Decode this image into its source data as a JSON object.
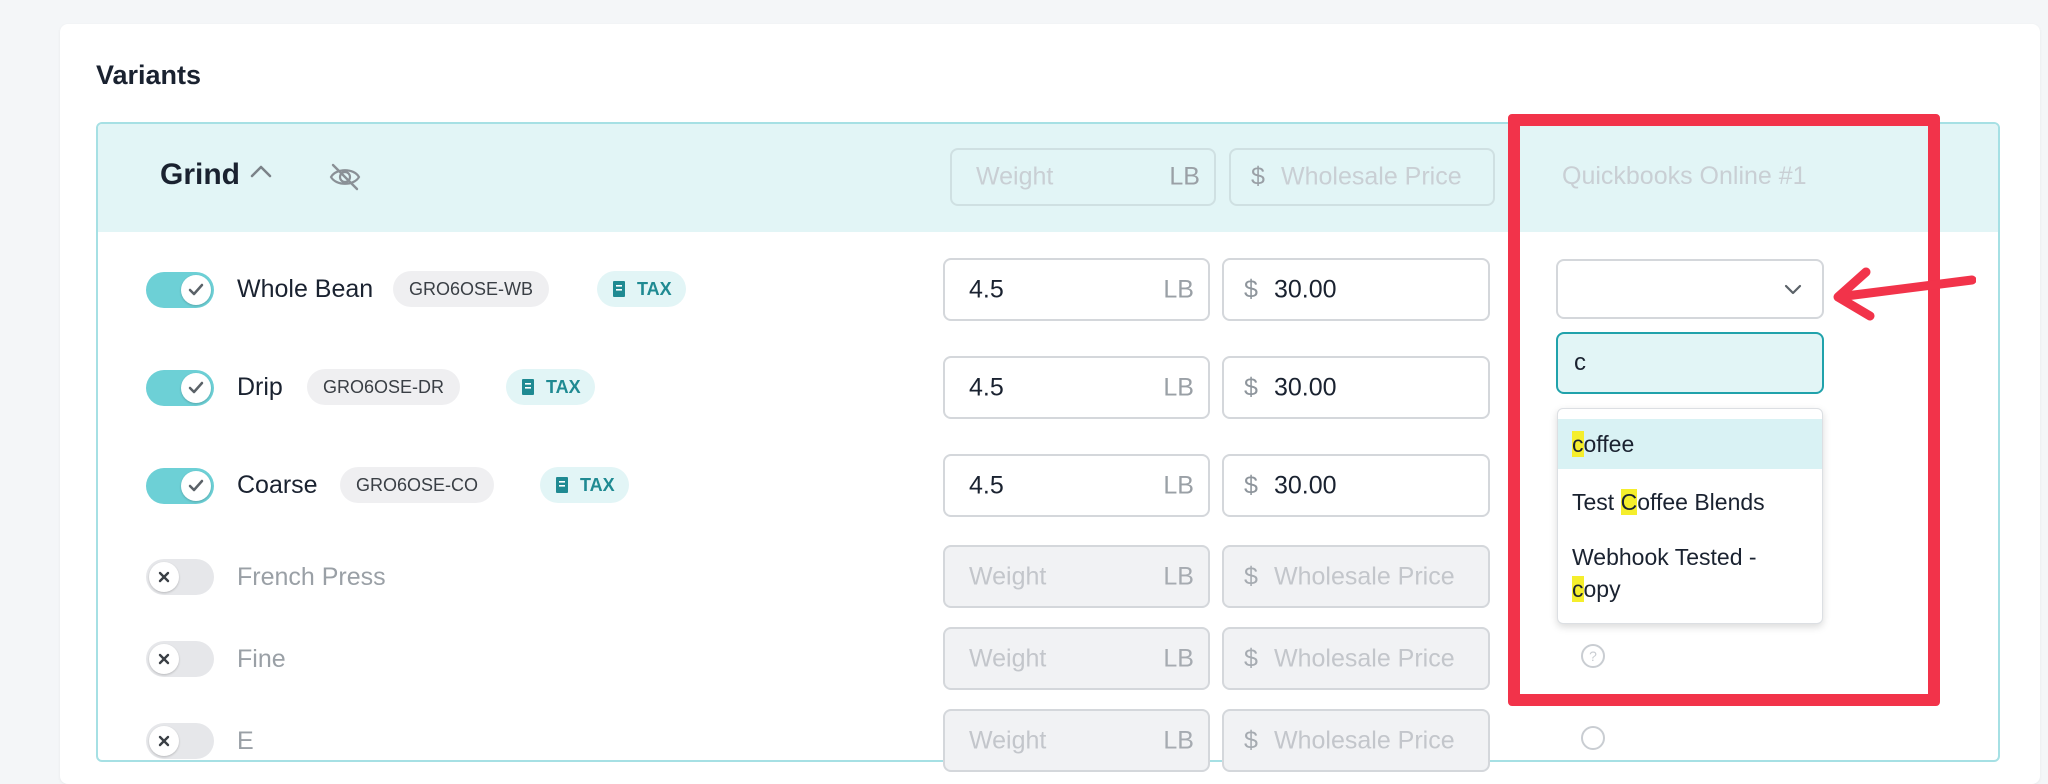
{
  "section_title": "Variants",
  "group": {
    "name": "Grind",
    "weight_placeholder": "Weight",
    "weight_unit": "LB",
    "currency_symbol": "$",
    "price_placeholder": "Wholesale Price",
    "integration_header": "Quickbooks Online #1"
  },
  "variants": [
    {
      "name": "Whole Bean",
      "enabled": true,
      "sku": "GRO6OSE-WB",
      "tax_label": "TAX",
      "weight": "4.5",
      "price": "30.00"
    },
    {
      "name": "Drip",
      "enabled": true,
      "sku": "GRO6OSE-DR",
      "tax_label": "TAX",
      "weight": "4.5",
      "price": "30.00"
    },
    {
      "name": "Coarse",
      "enabled": true,
      "sku": "GRO6OSE-CO",
      "tax_label": "TAX",
      "weight": "4.5",
      "price": "30.00"
    },
    {
      "name": "French Press",
      "enabled": false
    },
    {
      "name": "Fine",
      "enabled": false
    },
    {
      "name": "E",
      "enabled": false
    }
  ],
  "dropdown": {
    "search_value": "c",
    "options": [
      {
        "pre": "",
        "match": "c",
        "post": "offee",
        "selected": true
      },
      {
        "pre": "Test ",
        "match": "C",
        "post": "offee Blends",
        "selected": false
      },
      {
        "pre": "Webhook Tested - ",
        "match": "c",
        "post": "opy",
        "selected": false
      }
    ]
  },
  "colors": {
    "accent": "#6dd0d6",
    "header_bg": "#e2f5f6",
    "annotation_red": "#f2334a",
    "highlight": "#f5ee2c"
  }
}
